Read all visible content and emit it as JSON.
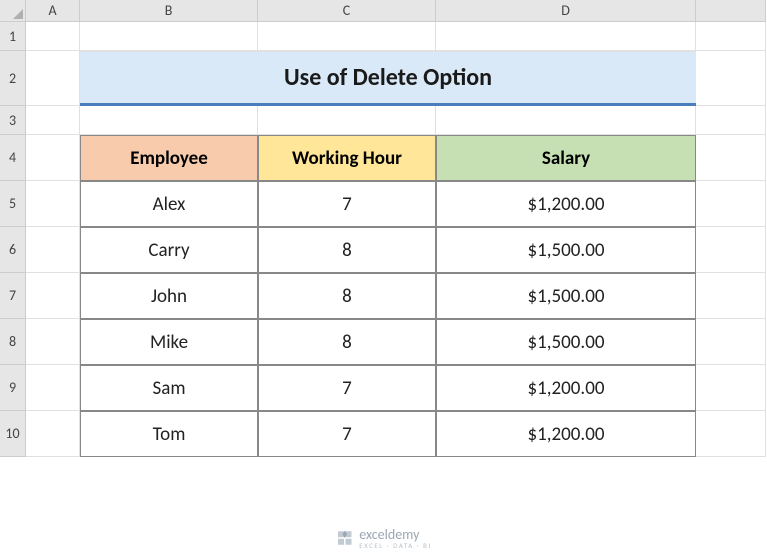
{
  "columns": [
    "A",
    "B",
    "C",
    "D"
  ],
  "rows": [
    "1",
    "2",
    "3",
    "4",
    "5",
    "6",
    "7",
    "8",
    "9",
    "10"
  ],
  "title": "Use of Delete Option",
  "headers": {
    "employee": "Employee",
    "working_hour": "Working Hour",
    "salary": "Salary"
  },
  "data": [
    {
      "employee": "Alex",
      "working_hour": "7",
      "salary": "$1,200.00"
    },
    {
      "employee": "Carry",
      "working_hour": "8",
      "salary": "$1,500.00"
    },
    {
      "employee": "John",
      "working_hour": "8",
      "salary": "$1,500.00"
    },
    {
      "employee": "Mike",
      "working_hour": "8",
      "salary": "$1,500.00"
    },
    {
      "employee": "Sam",
      "working_hour": "7",
      "salary": "$1,200.00"
    },
    {
      "employee": "Tom",
      "working_hour": "7",
      "salary": "$1,200.00"
    }
  ],
  "watermark": {
    "name": "exceldemy",
    "tagline": "EXCEL · DATA · BI"
  }
}
